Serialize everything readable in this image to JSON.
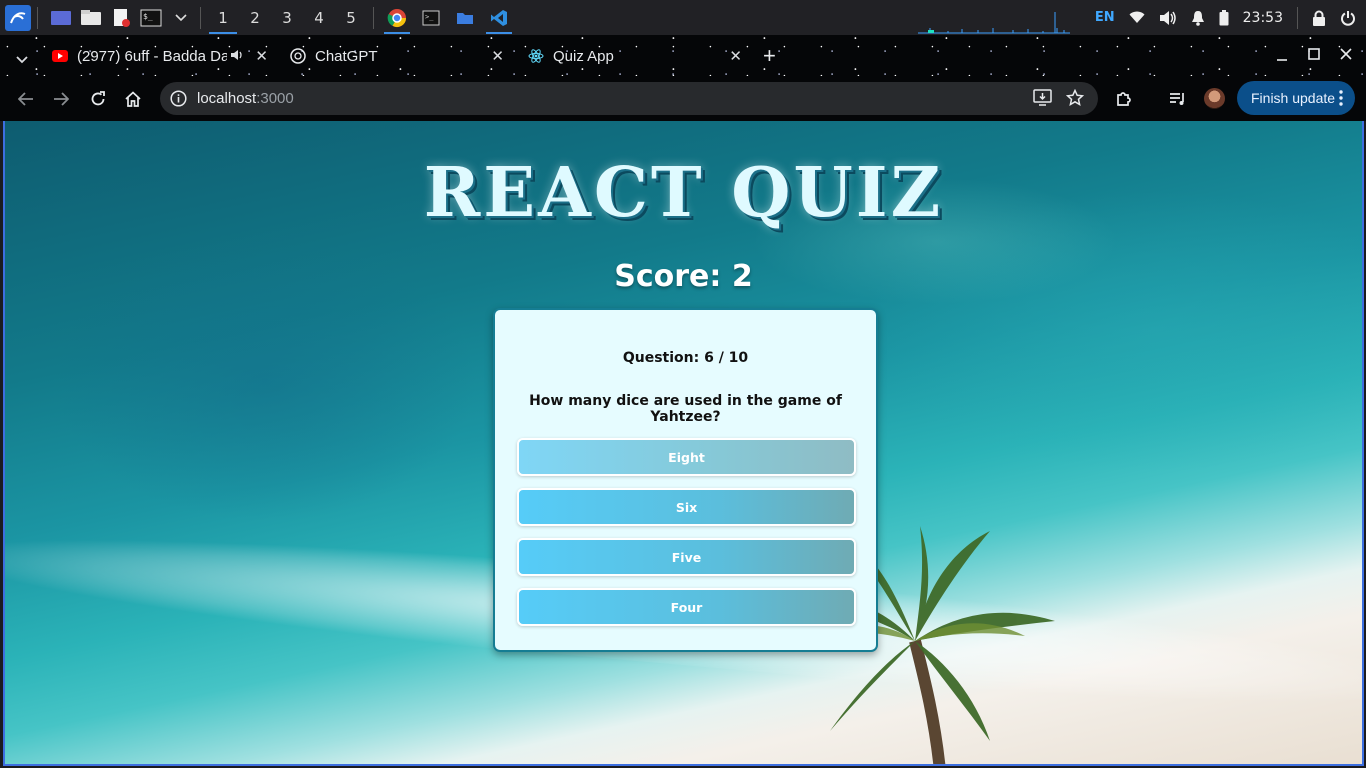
{
  "taskbar": {
    "workspaces": [
      "1",
      "2",
      "3",
      "4",
      "5"
    ],
    "active_workspace": "1",
    "language": "EN",
    "clock": "23:53"
  },
  "browser": {
    "tabs": [
      {
        "title": "(2977) 6uff - Badda Da",
        "favicon": "youtube-icon",
        "audio": true
      },
      {
        "title": "ChatGPT",
        "favicon": "openai-icon"
      },
      {
        "title": "Quiz App",
        "favicon": "react-icon",
        "active": true
      }
    ],
    "url_host": "localhost",
    "url_port": ":3000",
    "update_button": "Finish update"
  },
  "quiz": {
    "title": "REACT QUIZ",
    "score_label": "Score: 2",
    "question_counter": "Question: 6 / 10",
    "question": "How many dice are used in the game of Yahtzee?",
    "answers": [
      "Eight",
      "Six",
      "Five",
      "Four"
    ]
  },
  "colors": {
    "answer_button": "#56ccf8",
    "card_bg": "#e6fcff",
    "card_border": "#157d93",
    "accent": "#3c8ee6"
  }
}
